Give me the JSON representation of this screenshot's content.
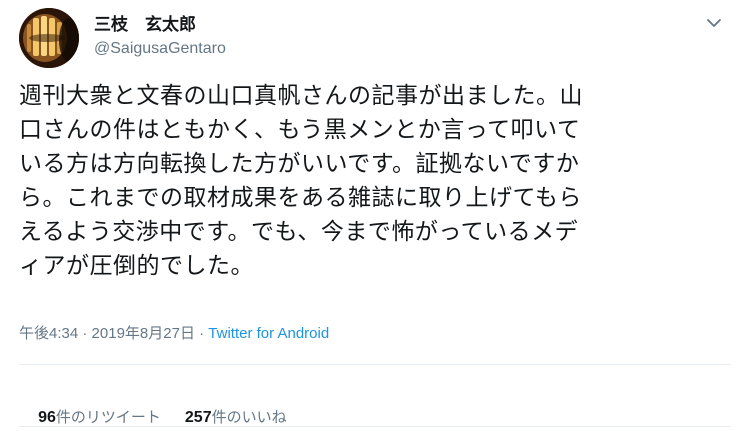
{
  "author": {
    "display_name": "三枝　玄太郎",
    "handle": "@SaigusaGentaro",
    "avatar_icon": "avatar-photo"
  },
  "menu": {
    "icon": "chevron-down-icon"
  },
  "tweet": {
    "lines": [
      "週刊大衆と文春の山口真帆さんの記事が出ました。山",
      "口さんの件はともかく、もう黒メンとか言って叩いて",
      "いる方は方向転換した方がいいです。証拠ないですか",
      "ら。これまでの取材成果をある雑誌に取り上げてもら",
      "えるよう交渉中です。でも、今まで怖がっているメデ",
      "ィアが圧倒的でした。"
    ]
  },
  "meta": {
    "time": "午後4:34",
    "separator": " · ",
    "date": "2019年8月27日",
    "source": "Twitter for Android"
  },
  "stats": {
    "retweets_count": "96",
    "retweets_label": "件のリツイート",
    "likes_count": "257",
    "likes_label": "件のいいね"
  },
  "colors": {
    "text": "#14171a",
    "secondary": "#657786",
    "link": "#1b95e0",
    "divider": "#e6ecf0"
  }
}
